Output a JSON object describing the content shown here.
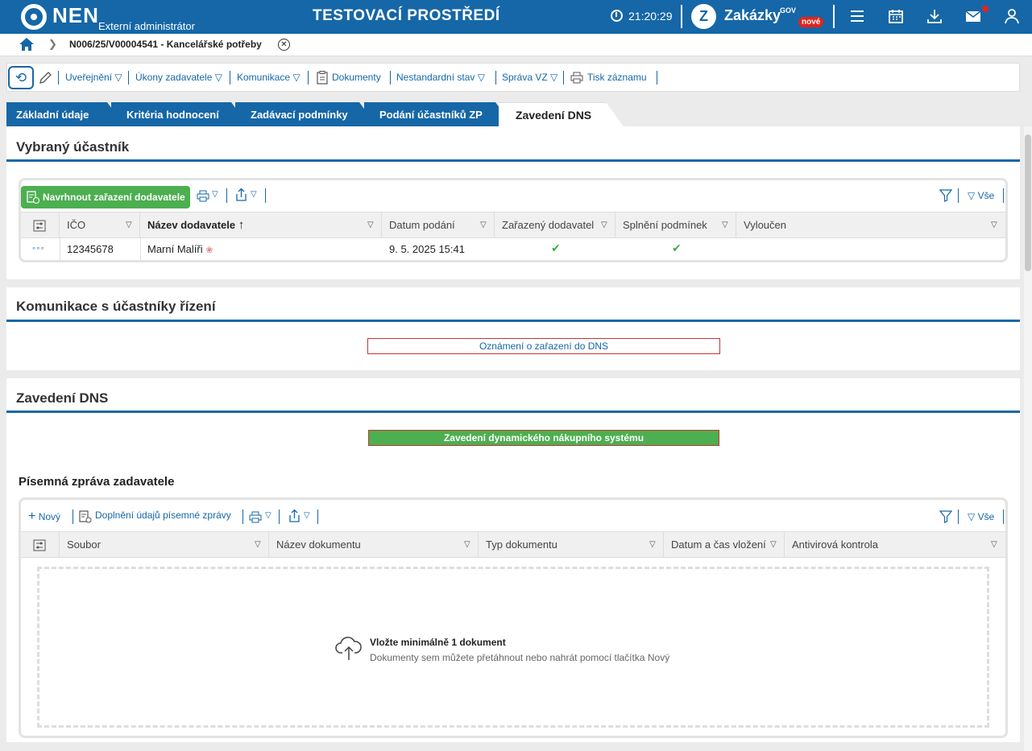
{
  "topbar": {
    "logo": "NEN",
    "subtitle": "Externí administrátor",
    "env_title": "TESTOVACÍ PROSTŘEDÍ",
    "time": "21:20:29",
    "zakazky": "Zakázky",
    "zakazky_gov": "GOV",
    "zakazky_badge": "nové",
    "zakazky_logo": "Z"
  },
  "breadcrumb": {
    "current": "N006/25/V00004541 - Kancelářské potřeby"
  },
  "toolbar": {
    "items": [
      "Uveřejnění",
      "Úkony zadavatele",
      "Komunikace",
      "Dokumenty",
      "Nestandardní stav",
      "Správa VZ",
      "Tisk záznamu"
    ]
  },
  "tabs": [
    "Základní údaje",
    "Kritéria hodnocení",
    "Zadávací podmínky",
    "Podání účastníků ZP",
    "Zavedení DNS"
  ],
  "selected_participant": {
    "title": "Vybraný účastník",
    "propose_button": "Navrhnout zařazení dodavatele",
    "filter_all": "Vše",
    "columns": [
      "IČO",
      "Název dodavatele",
      "Datum podání",
      "Zařazený dodavatel",
      "Splnění podmínek",
      "Vyloučen"
    ],
    "row": {
      "ico": "12345678",
      "name": "Marní Malíři",
      "date": "9. 5. 2025 15:41",
      "included": "✔",
      "conditions": "✔",
      "excluded": ""
    }
  },
  "communication": {
    "title": "Komunikace s účastníky řízení",
    "button": "Oznámení o zařazení do DNS"
  },
  "dns": {
    "title": "Zavedení DNS",
    "button": "Zavedení dynamického nákupního systému",
    "report_title": "Písemná zpráva zadavatele",
    "new_button": "Nový",
    "fill_button": "Doplnění údajů písemné zprávy",
    "filter_all": "Vše",
    "columns": [
      "Soubor",
      "Název dokumentu",
      "Typ dokumentu",
      "Datum a čas vložení",
      "Antivirová kontrola"
    ],
    "empty_title": "Vložte minimálně 1 dokument",
    "empty_sub": "Dokumenty sem můžete přetáhnout nebo nahrát pomocí tlačítka Nový"
  },
  "colors": {
    "brand_blue": "#1667a7",
    "green": "#4caf50",
    "red": "#e2231a"
  }
}
